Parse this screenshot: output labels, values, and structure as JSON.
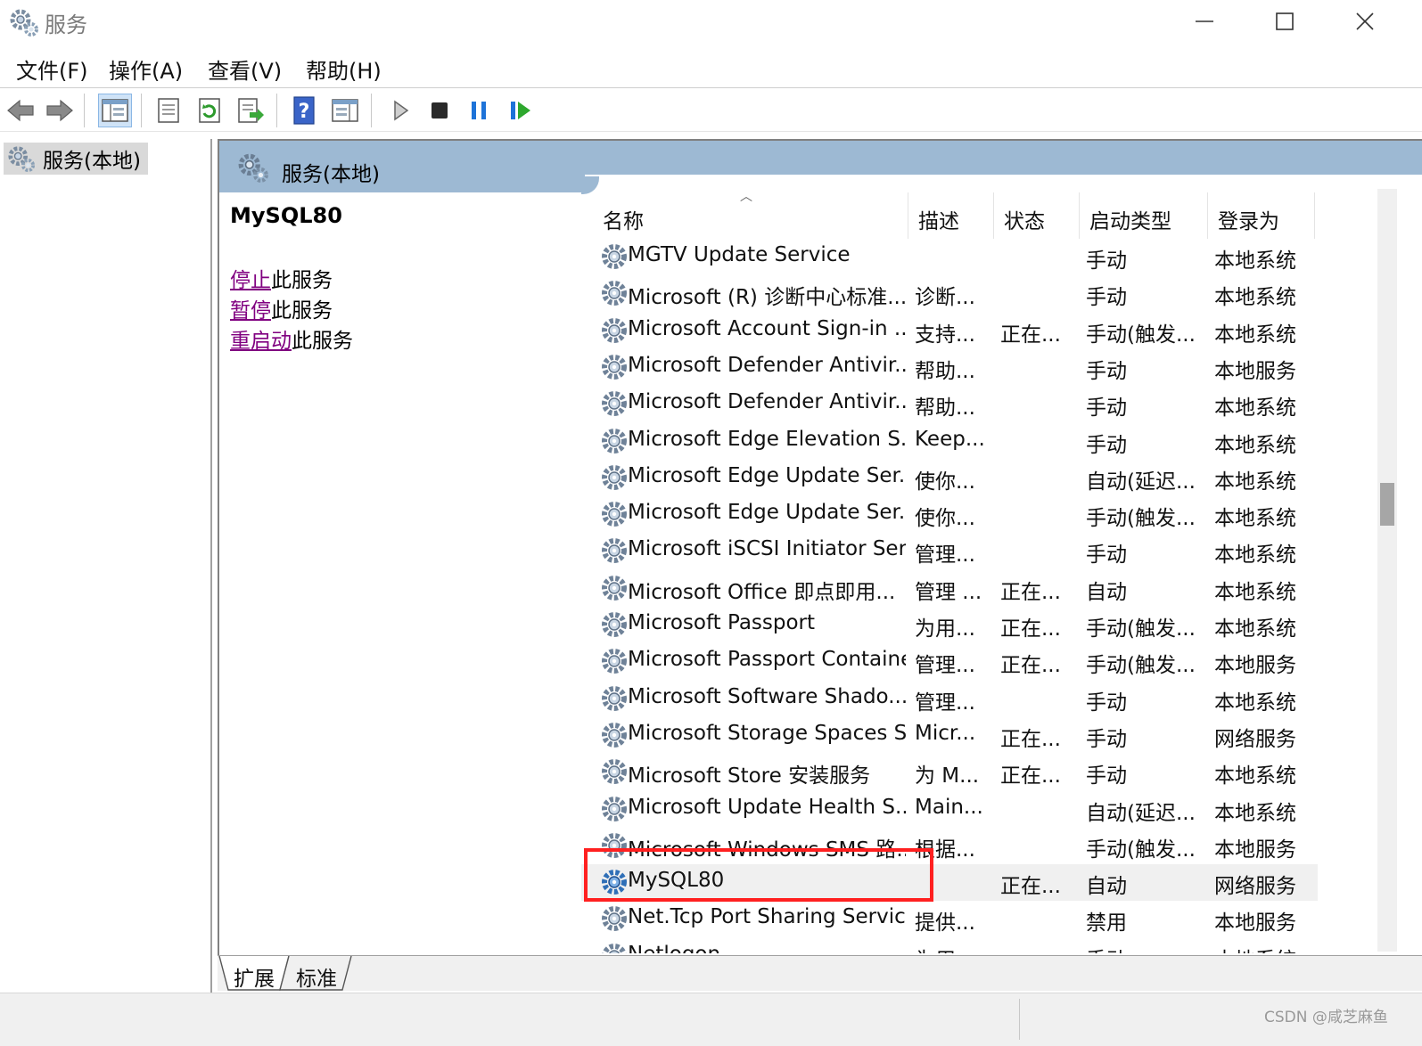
{
  "window": {
    "title": "服务"
  },
  "menu": [
    "文件(F)",
    "操作(A)",
    "查看(V)",
    "帮助(H)"
  ],
  "tree": {
    "root_label": "服务(本地)"
  },
  "panel": {
    "header_title": "服务(本地)",
    "selected_service": "MySQL80",
    "actions": [
      {
        "link": "停止",
        "suffix": "此服务"
      },
      {
        "link": "暂停",
        "suffix": "此服务"
      },
      {
        "link": "重启动",
        "suffix": "此服务"
      }
    ]
  },
  "table": {
    "columns": [
      "名称",
      "描述",
      "状态",
      "启动类型",
      "登录为"
    ],
    "rows": [
      [
        "MGTV Update Service",
        "",
        "",
        "手动",
        "本地系统"
      ],
      [
        "Microsoft (R) 诊断中心标准...",
        "诊断...",
        "",
        "手动",
        "本地系统"
      ],
      [
        "Microsoft Account Sign-in ...",
        "支持...",
        "正在...",
        "手动(触发...",
        "本地系统"
      ],
      [
        "Microsoft Defender Antivir...",
        "帮助...",
        "",
        "手动",
        "本地服务"
      ],
      [
        "Microsoft Defender Antivir...",
        "帮助...",
        "",
        "手动",
        "本地系统"
      ],
      [
        "Microsoft Edge Elevation S...",
        "Keep...",
        "",
        "手动",
        "本地系统"
      ],
      [
        "Microsoft Edge Update Ser...",
        "使你...",
        "",
        "自动(延迟...",
        "本地系统"
      ],
      [
        "Microsoft Edge Update Ser...",
        "使你...",
        "",
        "手动(触发...",
        "本地系统"
      ],
      [
        "Microsoft iSCSI Initiator Ser...",
        "管理...",
        "",
        "手动",
        "本地系统"
      ],
      [
        "Microsoft Office 即点即用...",
        "管理 ...",
        "正在...",
        "自动",
        "本地系统"
      ],
      [
        "Microsoft Passport",
        "为用...",
        "正在...",
        "手动(触发...",
        "本地系统"
      ],
      [
        "Microsoft Passport Container",
        "管理...",
        "正在...",
        "手动(触发...",
        "本地服务"
      ],
      [
        "Microsoft Software Shado...",
        "管理...",
        "",
        "手动",
        "本地系统"
      ],
      [
        "Microsoft Storage Spaces S...",
        "Micr...",
        "正在...",
        "手动",
        "网络服务"
      ],
      [
        "Microsoft Store 安装服务",
        "为 M...",
        "正在...",
        "手动",
        "本地系统"
      ],
      [
        "Microsoft Update Health S...",
        "Main...",
        "",
        "自动(延迟...",
        "本地系统"
      ],
      [
        "Microsoft Windows SMS 路...",
        "根据...",
        "",
        "手动(触发...",
        "本地服务"
      ],
      [
        "MySQL80",
        "",
        "正在...",
        "自动",
        "网络服务"
      ],
      [
        "Net.Tcp Port Sharing Service",
        "提供...",
        "",
        "禁用",
        "本地服务"
      ],
      [
        "Netlogon",
        "为用...",
        "",
        "手动",
        "本地系统"
      ]
    ],
    "selected_index": 17
  },
  "tabs": [
    "扩展",
    "标准"
  ],
  "watermark": "CSDN @咸芝麻鱼"
}
